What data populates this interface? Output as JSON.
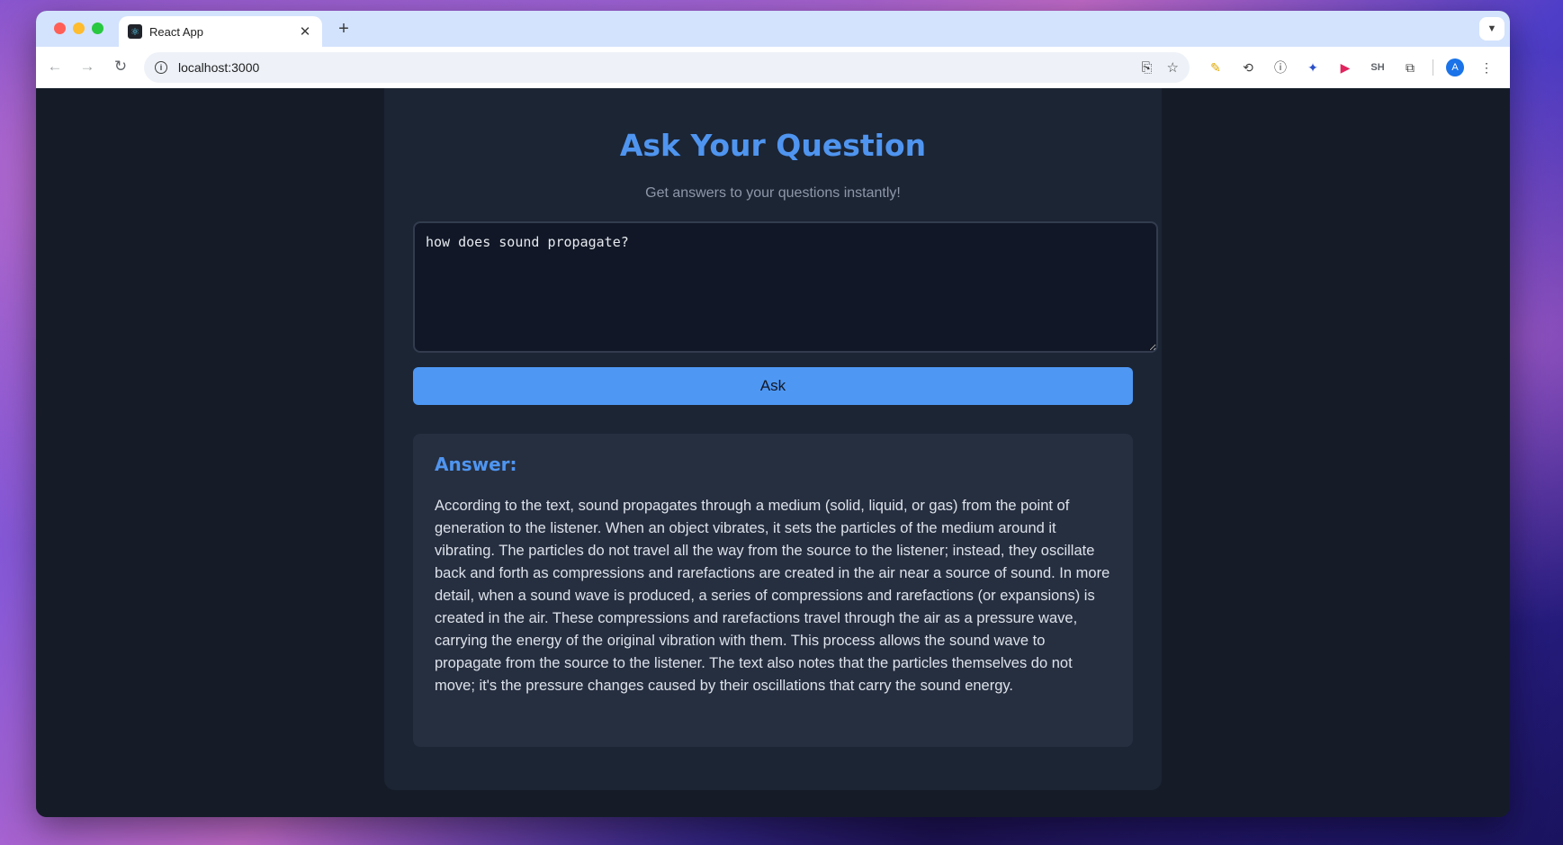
{
  "browser": {
    "tab_title": "React App",
    "tab_favicon": "react-icon",
    "url": "localhost:3000",
    "ext_sh_label": "SH",
    "avatar_letter": "A"
  },
  "page": {
    "title": "Ask Your Question",
    "subtitle": "Get answers to your questions instantly!",
    "question_value": "how does sound propagate?",
    "ask_label": "Ask",
    "answer_heading": "Answer:",
    "answer_text": "According to the text, sound propagates through a medium (solid, liquid, or gas) from the point of generation to the listener. When an object vibrates, it sets the particles of the medium around it vibrating. The particles do not travel all the way from the source to the listener; instead, they oscillate back and forth as compressions and rarefactions are created in the air near a source of sound. In more detail, when a sound wave is produced, a series of compressions and rarefactions (or expansions) is created in the air. These compressions and rarefactions travel through the air as a pressure wave, carrying the energy of the original vibration with them. This process allows the sound wave to propagate from the source to the listener. The text also notes that the particles themselves do not move; it's the pressure changes caused by their oscillations that carry the sound energy."
  },
  "colors": {
    "accent": "#4f95f0",
    "button": "#4e98f4",
    "background": "#151c28",
    "card": "#1c2534"
  }
}
